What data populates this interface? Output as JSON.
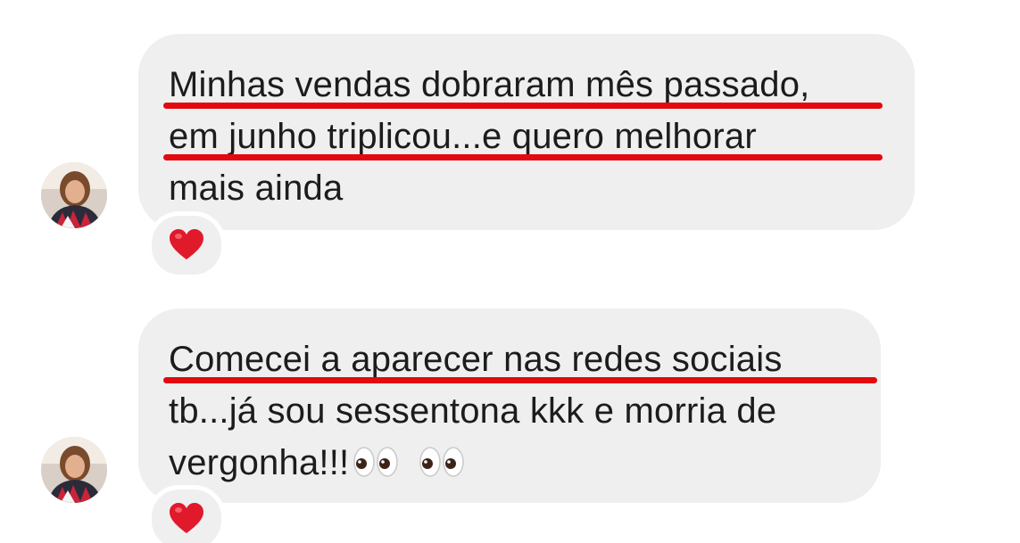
{
  "messages": [
    {
      "lines": [
        "Minhas vendas dobraram mês passado,",
        "em junho triplicou...e quero melhorar",
        "mais ainda"
      ],
      "underlined_lines": [
        0,
        1
      ],
      "reaction": "heart-icon",
      "sender_avatar": "avatar"
    },
    {
      "lines": [
        "Comecei a aparecer nas redes sociais",
        "tb...já sou sessentona kkk e morria de",
        "vergonha!!!"
      ],
      "underlined_lines": [
        0
      ],
      "trailing_emojis": [
        "eyes-icon",
        "eyes-icon"
      ],
      "reaction": "heart-icon",
      "sender_avatar": "avatar"
    }
  ],
  "colors": {
    "bubble": "#efefef",
    "text": "#1c1c1c",
    "underline": "#e20a10",
    "heart": "#e0192b"
  }
}
